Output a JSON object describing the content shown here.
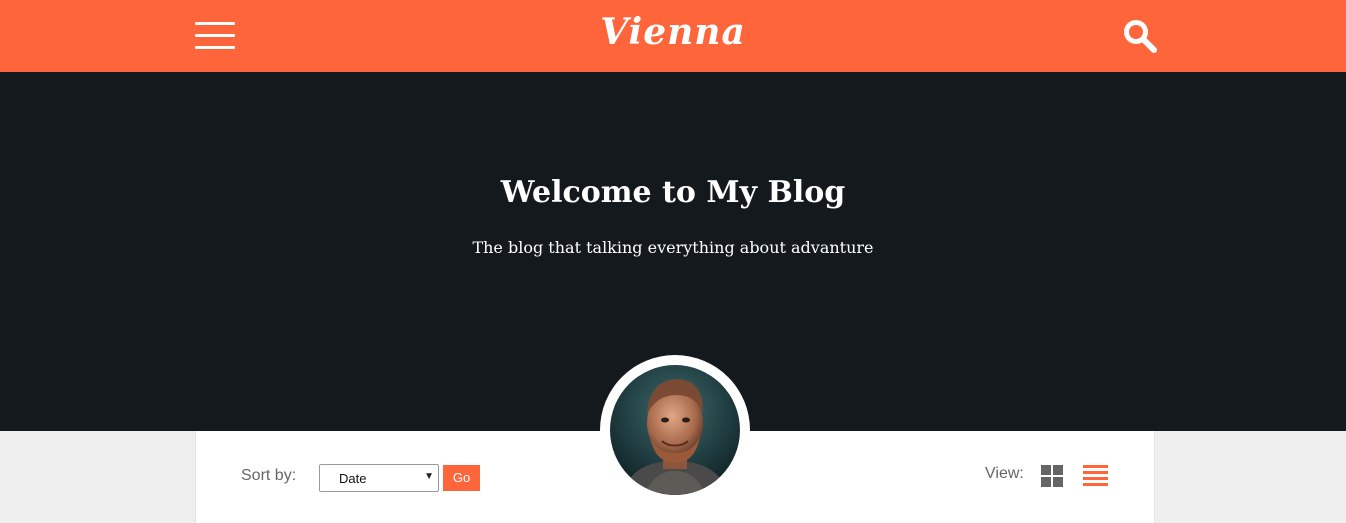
{
  "header": {
    "logo_text": "Vienna",
    "menu_icon": "hamburger-menu-icon",
    "search_icon": "search-icon",
    "brand_color": "#ff653b"
  },
  "hero": {
    "title": "Welcome to My Blog",
    "subtitle": "The blog that talking everything about advanture",
    "background_color": "#14191d"
  },
  "toolbar": {
    "sort_label": "Sort by:",
    "sort_selected": "Date",
    "go_label": "Go",
    "view_label": "View:",
    "grid_view_icon": "grid-view-icon",
    "list_view_icon": "list-view-icon",
    "active_view": "list"
  },
  "profile": {
    "avatar_icon": "author-avatar"
  }
}
